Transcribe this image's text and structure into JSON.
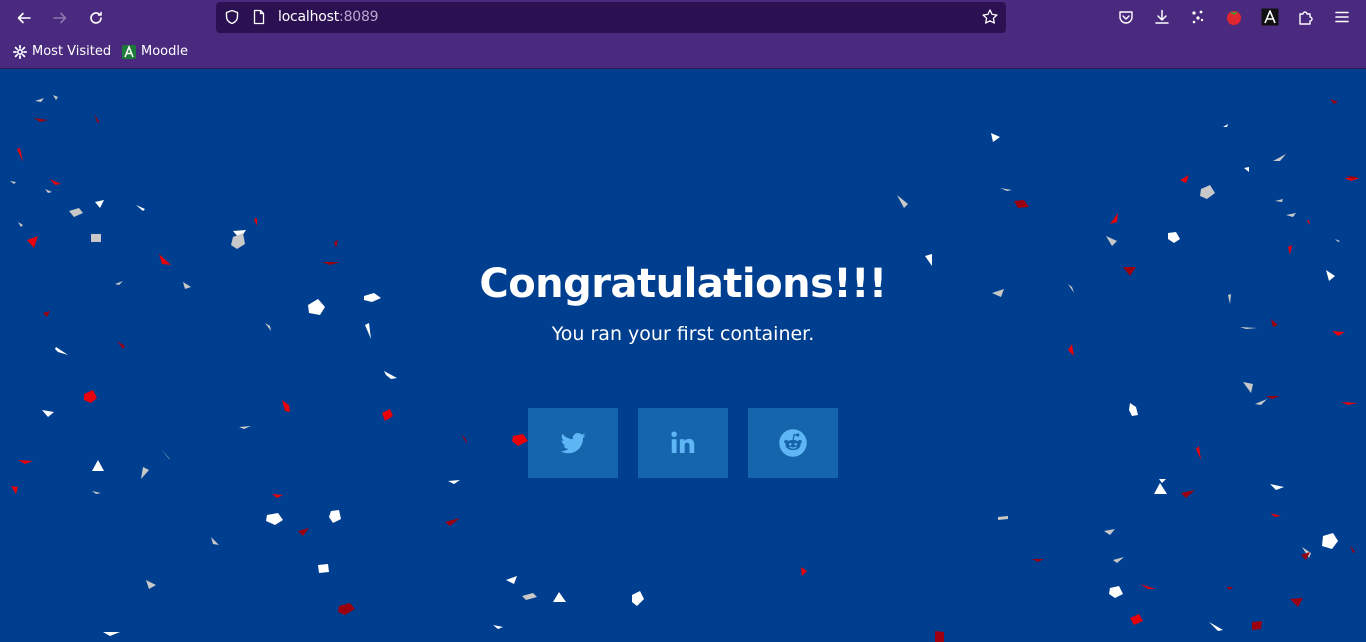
{
  "browser": {
    "url_host": "localhost",
    "url_port": ":8089",
    "bookmarks": [
      {
        "label": "Most Visited",
        "icon": "gear-icon"
      },
      {
        "label": "Moodle",
        "icon": "moodle-icon"
      }
    ],
    "toolbar_icons": [
      "pocket-icon",
      "download-icon",
      "extension-icon",
      "tomato-icon",
      "font-a-icon",
      "puzzle-icon",
      "menu-icon"
    ]
  },
  "page": {
    "title": "Congratulations!!!",
    "subtitle": "You ran your first container.",
    "share_buttons": [
      {
        "name": "twitter",
        "icon": "twitter-icon"
      },
      {
        "name": "linkedin",
        "icon": "linkedin-icon"
      },
      {
        "name": "reddit",
        "icon": "reddit-icon"
      }
    ]
  },
  "colors": {
    "background": "#003f8f",
    "button": "#1565ad",
    "icon": "#5eb6f5",
    "chrome": "#4a2a7e",
    "confetti_red": "#e8000b",
    "confetti_white": "#ffffff",
    "confetti_grey": "#c8c8c8"
  }
}
